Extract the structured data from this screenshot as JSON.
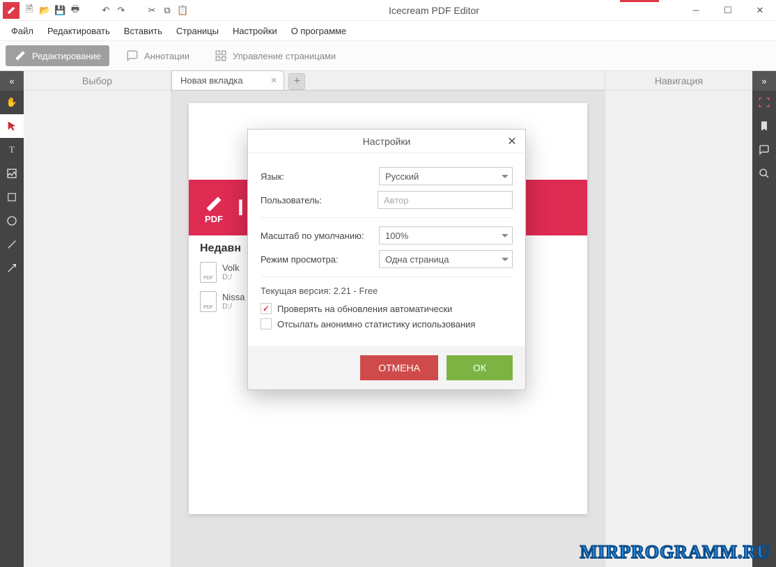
{
  "app": {
    "title": "Icecream PDF Editor"
  },
  "menu": {
    "file": "Файл",
    "edit": "Редактировать",
    "insert": "Вставить",
    "pages": "Страницы",
    "settings": "Настройки",
    "about": "О программе"
  },
  "modes": {
    "edit": "Редактирование",
    "annotate": "Аннотации",
    "pages": "Управление страницами"
  },
  "panels": {
    "left": "Выбор",
    "right": "Навигация"
  },
  "tabs": {
    "t1": "Новая вкладка"
  },
  "recent": {
    "heading": "Недавн",
    "r1_name": "Volk",
    "r1_path": "D:/",
    "r2_name": "Nissa",
    "r2_path": "D:/",
    "file_badge": "PDF",
    "banner_letter": "I",
    "pdf_label": "PDF"
  },
  "dialog": {
    "title": "Настройки",
    "lang_label": "Язык:",
    "lang_value": "Русский",
    "user_label": "Пользователь:",
    "user_placeholder": "Автор",
    "zoom_label": "Масштаб по умолчанию:",
    "zoom_value": "100%",
    "view_label": "Режим просмотра:",
    "view_value": "Одна страница",
    "version": "Текущая версия: 2.21 - Free",
    "chk_updates": "Проверять на обновления автоматически",
    "chk_stats": "Отсылать анонимно статистику использования",
    "cancel": "ОТМЕНА",
    "ok": "ОК"
  },
  "watermark": "MIRPROGRAMM.RU"
}
